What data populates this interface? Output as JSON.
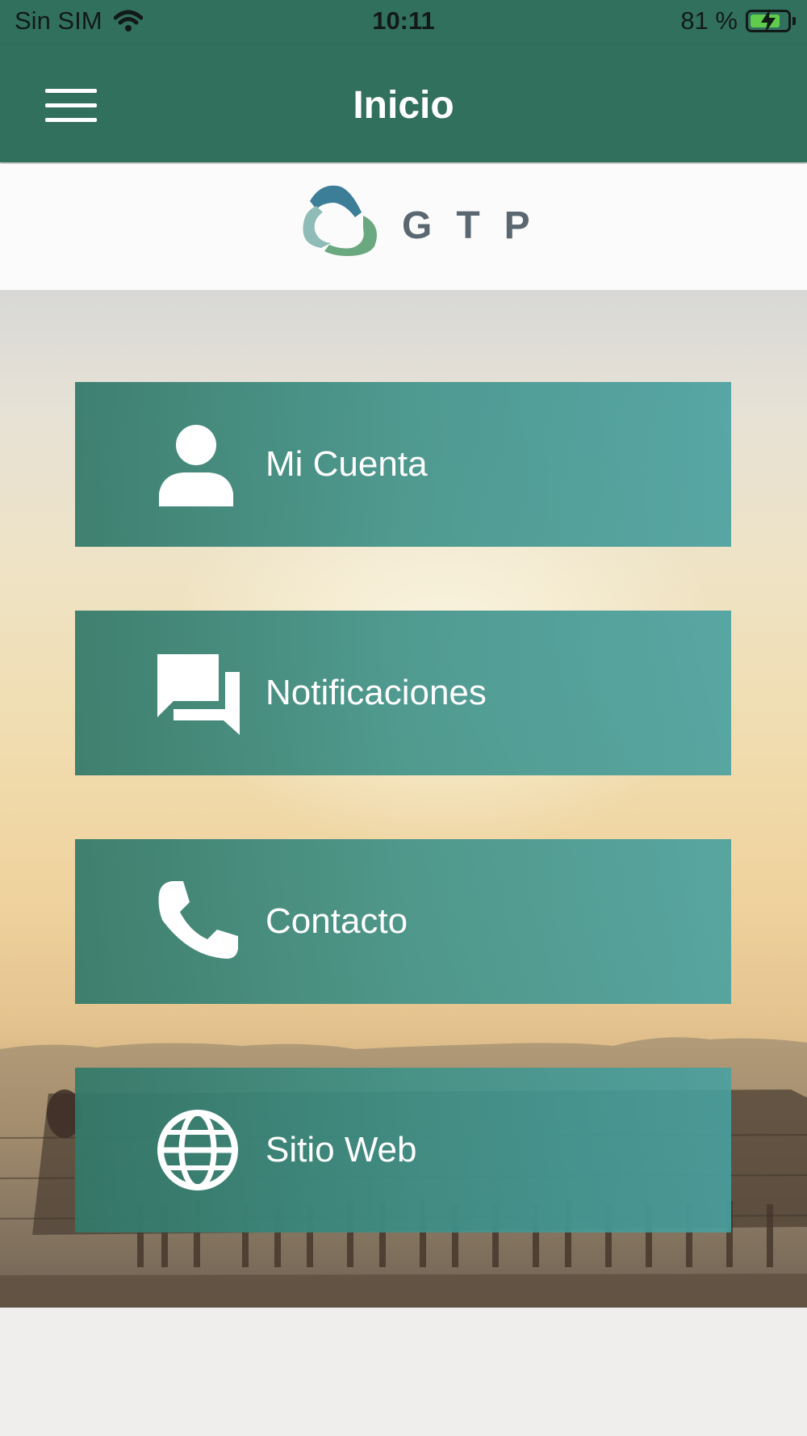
{
  "status_bar": {
    "carrier": "Sin SIM",
    "time": "10:11",
    "battery": "81 %",
    "battery_level": 0.81
  },
  "nav": {
    "title": "Inicio"
  },
  "logo": {
    "text": "GTP"
  },
  "menu": [
    {
      "label": "Mi Cuenta",
      "icon": "user-icon"
    },
    {
      "label": "Notificaciones",
      "icon": "chat-icon"
    },
    {
      "label": "Contacto",
      "icon": "phone-icon"
    },
    {
      "label": "Sitio Web",
      "icon": "globe-icon"
    }
  ],
  "colors": {
    "primary": "#32705e",
    "button_start": "#327969",
    "button_end": "#48a0a0",
    "logo_text": "#5b6770"
  }
}
